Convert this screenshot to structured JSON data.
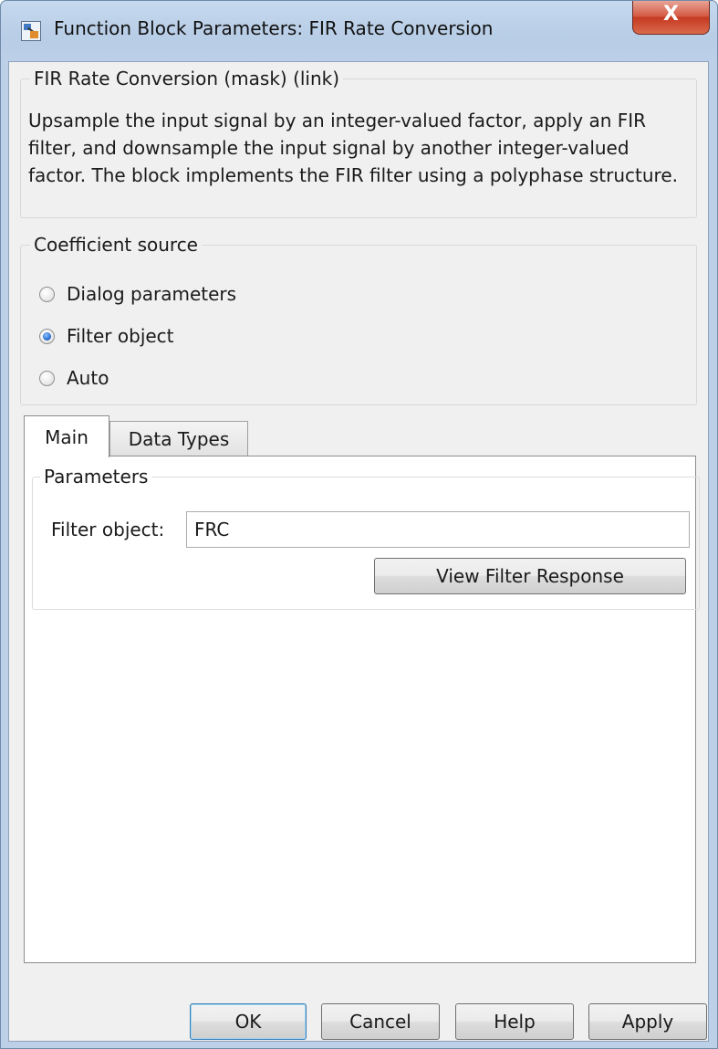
{
  "window": {
    "title": "Function Block Parameters: FIR Rate Conversion",
    "close_label": "X"
  },
  "mask": {
    "legend": "FIR Rate Conversion (mask) (link)",
    "description": "Upsample the input signal by an integer-valued factor, apply an FIR filter, and downsample the input signal by another integer-valued factor. The block implements the FIR filter using a polyphase structure."
  },
  "coefficient_source": {
    "legend": "Coefficient source",
    "options": [
      {
        "label": "Dialog parameters",
        "checked": false
      },
      {
        "label": "Filter object",
        "checked": true
      },
      {
        "label": "Auto",
        "checked": false
      }
    ]
  },
  "tabs": [
    {
      "label": "Main",
      "active": true
    },
    {
      "label": "Data Types",
      "active": false
    }
  ],
  "parameters": {
    "legend": "Parameters",
    "filter_object_label": "Filter object:",
    "filter_object_value": "FRC",
    "view_response_label": "View Filter Response"
  },
  "buttons": {
    "ok": "OK",
    "cancel": "Cancel",
    "help": "Help",
    "apply": "Apply"
  }
}
